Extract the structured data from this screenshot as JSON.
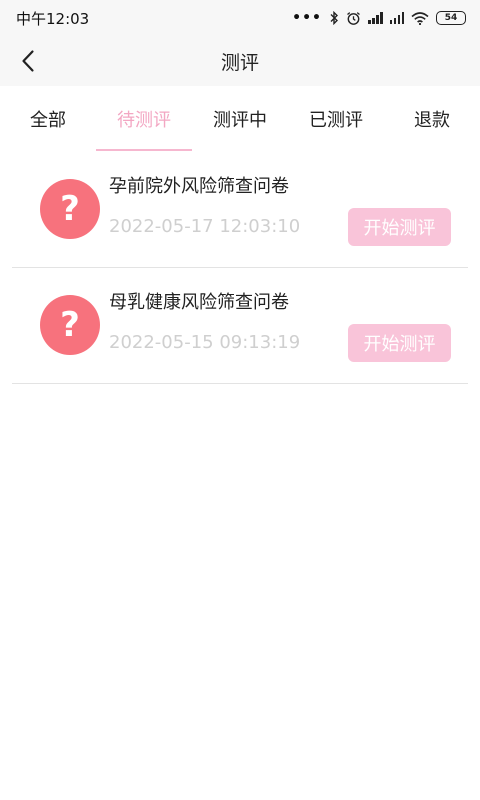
{
  "status_bar": {
    "time": "中午12:03",
    "dots": "•••",
    "battery": "54"
  },
  "header": {
    "title": "测评"
  },
  "tabs": [
    {
      "label": "全部",
      "active": false
    },
    {
      "label": "待测评",
      "active": true
    },
    {
      "label": "测评中",
      "active": false
    },
    {
      "label": "已测评",
      "active": false
    },
    {
      "label": "退款",
      "active": false
    }
  ],
  "items": [
    {
      "title": "孕前院外风险筛查问卷",
      "date": "2022-05-17 12:03:10",
      "icon_text": "?",
      "button": "开始测评"
    },
    {
      "title": "母乳健康风险筛查问卷",
      "date": "2022-05-15 09:13:19",
      "icon_text": "?",
      "button": "开始测评"
    }
  ],
  "colors": {
    "accent": "#f3a7c3",
    "icon_bg": "#f7727d",
    "button_bg": "#f9c4d9",
    "date_text": "#cfcfcf"
  }
}
